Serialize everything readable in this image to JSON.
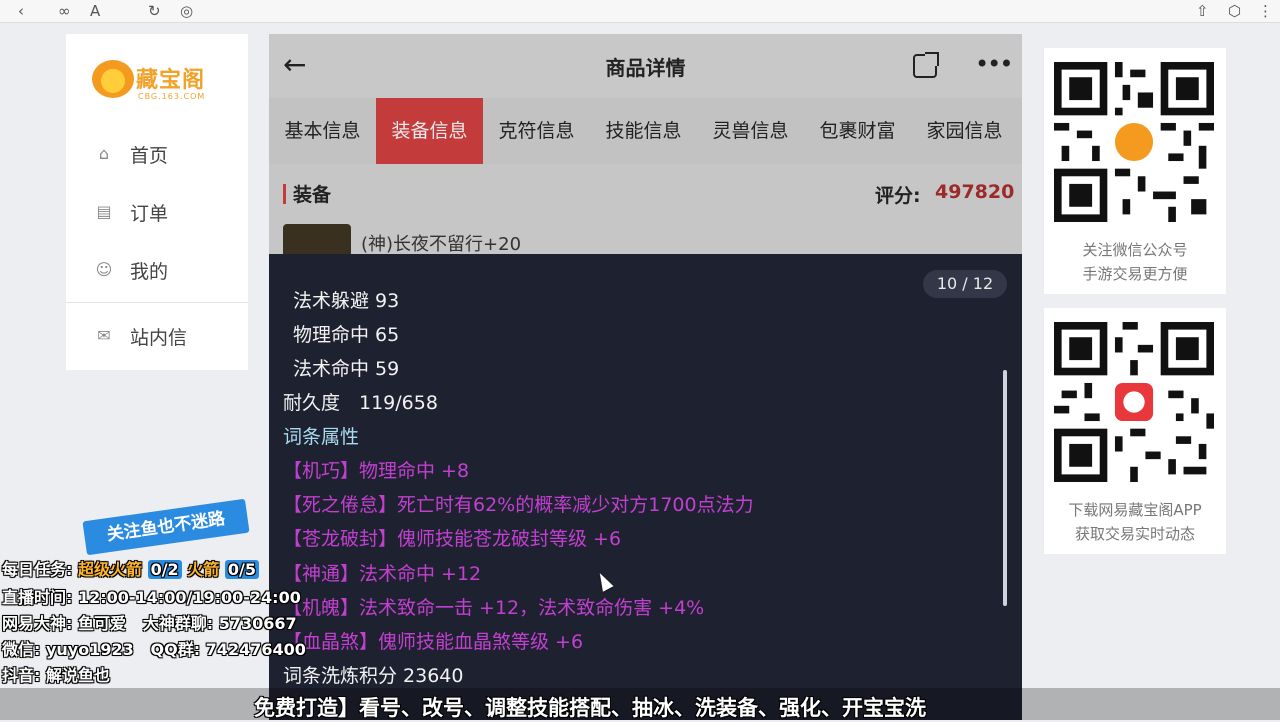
{
  "browser": {
    "icons": [
      "back-icon",
      "link-icon",
      "font-size-icon",
      "refresh-icon",
      "compass-icon",
      "share-icon",
      "extension-icon",
      "menu-icon"
    ]
  },
  "sidebar": {
    "logo_text": "藏宝阁",
    "logo_sub": "CBG.163.COM",
    "items": [
      {
        "label": "首页",
        "icon": "home-icon"
      },
      {
        "label": "订单",
        "icon": "order-icon"
      },
      {
        "label": "我的",
        "icon": "user-icon"
      },
      {
        "label": "站内信",
        "icon": "mail-icon"
      }
    ]
  },
  "header": {
    "title": "商品详情",
    "back": "←",
    "more": "•••"
  },
  "tabs": [
    "基本信息",
    "装备信息",
    "克符信息",
    "技能信息",
    "灵兽信息",
    "包裹财富",
    "家园信息"
  ],
  "active_tab": 1,
  "section": {
    "title": "装备",
    "score_label": "评分:",
    "score_value": "497820"
  },
  "item": {
    "name": "(神)长夜不留行+20"
  },
  "popup": {
    "counter": "10 / 12",
    "lines": [
      {
        "text": "法术躲避 93",
        "style": "white"
      },
      {
        "text": "物理命中 65",
        "style": "white"
      },
      {
        "text": "法术命中 59",
        "style": "white"
      },
      {
        "text": "耐久度　119/658",
        "style": "white"
      },
      {
        "text": "词条属性",
        "style": "cyan"
      },
      {
        "text": "【机巧】物理命中 +8",
        "style": "pink"
      },
      {
        "text": "【死之倦怠】死亡时有62%的概率减少对方1700点法力",
        "style": "pink"
      },
      {
        "text": "【苍龙破封】傀师技能苍龙破封等级 +6",
        "style": "pink"
      },
      {
        "text": "【神通】法术命中 +12",
        "style": "pink"
      },
      {
        "text": "【机魄】法术致命一击 +12，法术致命伤害 +4%",
        "style": "pink"
      },
      {
        "text": "【血晶煞】傀师技能血晶煞等级 +6",
        "style": "pink"
      },
      {
        "text": "词条洗炼积分 23640",
        "style": "white"
      }
    ]
  },
  "qr_cards": [
    {
      "caption1": "关注微信公众号",
      "caption2": "手游交易更方便"
    },
    {
      "caption1": "下载网易藏宝阁APP",
      "caption2": "获取交易实时动态"
    }
  ],
  "streamer": {
    "ribbon": "关注鱼也不迷路",
    "task_label": "每日任务:",
    "task1": "超级火箭",
    "task1_count": "0/2",
    "task2": "火箭",
    "task2_count": "0/5",
    "live_time_label": "直播时间:",
    "live_time": "12:00-14:00/19:00-24:00",
    "dashen_label": "网易大神:",
    "dashen": "鱼可爱",
    "group_label": "大神群聊:",
    "group": "5730667",
    "wechat_label": "微信:",
    "wechat": "yuyo1923",
    "qq_label": "QQ群:",
    "qq": "742476400",
    "douyin_label": "抖音:",
    "douyin": "解说鱼也"
  },
  "ticker": "免费打造】看号、改号、调整技能搭配、抽冰、洗装备、强化、开宝宝洗"
}
